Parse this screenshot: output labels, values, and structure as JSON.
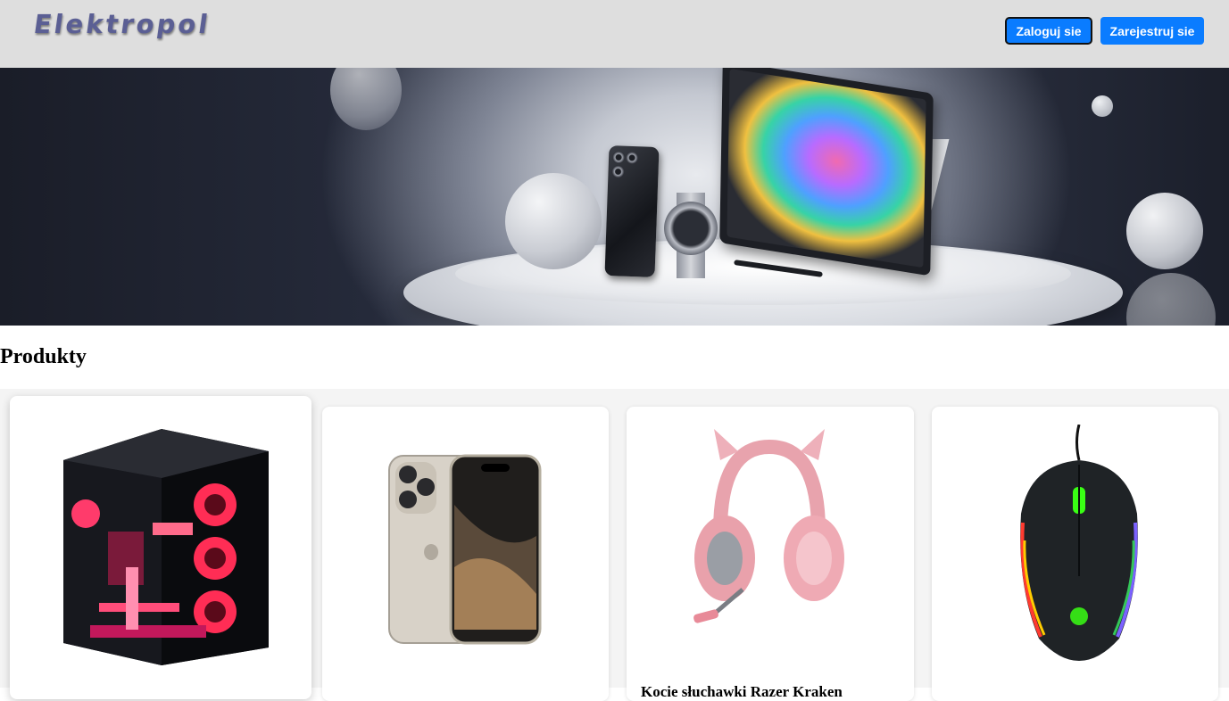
{
  "header": {
    "logo": "Elektropol",
    "login_label": "Zaloguj sie",
    "register_label": "Zarejestruj sie"
  },
  "banner": {
    "alt": "hero-banner-electronics"
  },
  "section": {
    "title": "Produkty"
  },
  "products": [
    {
      "name": "",
      "image": "pc-case-image"
    },
    {
      "name": "",
      "image": "smartphone-image"
    },
    {
      "name": "Kocie słuchawki Razer Kraken",
      "image": "headset-image"
    },
    {
      "name": "",
      "image": "mouse-image"
    }
  ],
  "colors": {
    "header_bg": "#dedede",
    "button_bg": "#0a7cff",
    "logo": "#5b5f94",
    "products_bg": "#f4f4f4"
  }
}
